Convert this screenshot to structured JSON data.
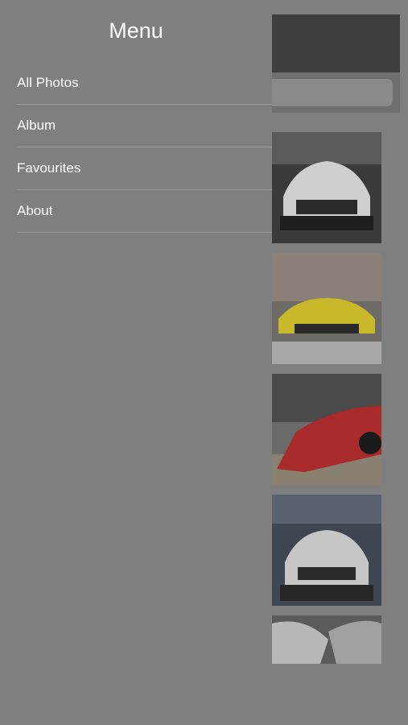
{
  "drawer": {
    "title": "Menu",
    "items": [
      {
        "label": "All Photos"
      },
      {
        "label": "Album"
      },
      {
        "label": "Favourites"
      },
      {
        "label": "About"
      }
    ]
  },
  "gallery": {
    "thumbnails": [
      {
        "name": "white-car-front"
      },
      {
        "name": "yellow-car-front"
      },
      {
        "name": "red-car-side"
      },
      {
        "name": "white-car-studio"
      },
      {
        "name": "car-closeup"
      }
    ]
  },
  "colors": {
    "overlay": "#7f7f7f",
    "header": "#3e3e3e",
    "text": "#ffffff"
  }
}
